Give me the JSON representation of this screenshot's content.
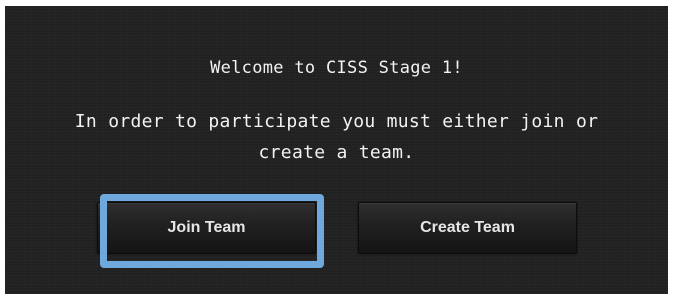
{
  "dialog": {
    "welcome_text": "Welcome to CISS Stage 1!",
    "instruction_text": "In order to participate you must either join or create a team."
  },
  "buttons": {
    "join_label": "Join Team",
    "create_label": "Create Team"
  },
  "colors": {
    "panel_background": "#222222",
    "text": "#f2f2f2",
    "button_text": "#e6e6e6",
    "focus_highlight": "#6fa8dc"
  }
}
